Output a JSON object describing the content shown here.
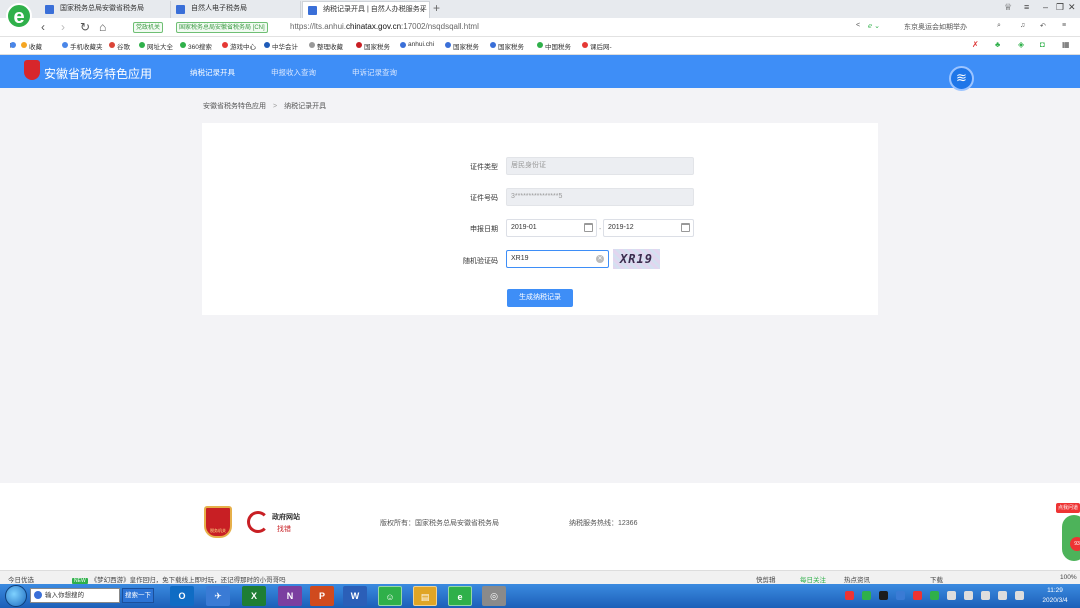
{
  "browser": {
    "logo_letter": "e",
    "tabs": [
      {
        "label": "国家税务总局安徽省税务局"
      },
      {
        "label": "自然人电子税务局"
      },
      {
        "label": "纳税记录开具 | 自然人办税服务平"
      }
    ],
    "tab_close": "×",
    "new_tab": "+",
    "addr": {
      "badge_gov": "党政机关",
      "badge_site": "国家税务总局安徽省税务局 [CN]",
      "url_prefix": "https://lts.anhui.",
      "url_domain": "chinatax.gov.cn",
      "url_suffix": ":17002/nsqdsqall.html",
      "news_hint": "东京奥运会如期举办"
    },
    "bookmarks": [
      {
        "label": "收藏",
        "color": "#f5a623"
      },
      {
        "label": "手机收藏夹",
        "color": "#4a86e8"
      },
      {
        "label": "谷歌",
        "color": "#db4437"
      },
      {
        "label": "网址大全",
        "color": "#2fb04a"
      },
      {
        "label": "360搜索",
        "color": "#2fb04a"
      },
      {
        "label": "游戏中心",
        "color": "#e53935"
      },
      {
        "label": "中华会计",
        "color": "#1e5bb8"
      },
      {
        "label": "整理收藏",
        "color": "#999999"
      },
      {
        "label": "国家税务",
        "color": "#c81f24"
      },
      {
        "label": "anhui.chi",
        "color": "#3a6fd8"
      },
      {
        "label": "国家税务",
        "color": "#3a6fd8"
      },
      {
        "label": "国家税务",
        "color": "#3a6fd8"
      },
      {
        "label": "中国税务",
        "color": "#2fb04a"
      },
      {
        "label": "课后网-",
        "color": "#e53935"
      }
    ]
  },
  "site": {
    "title": "安徽省税务特色应用",
    "nav": [
      {
        "label": "纳税记录开具"
      },
      {
        "label": "申报收入查询"
      },
      {
        "label": "申诉记录查询"
      }
    ],
    "breadcrumb": {
      "root": "安徽省税务特色应用",
      "sep": ">",
      "current": "纳税记录开具"
    }
  },
  "form": {
    "id_type_label": "证件类型",
    "id_type_value": "居民身份证",
    "id_number_label": "证件号码",
    "id_number_value": "3****************5",
    "date_label": "申报日期",
    "date_start": "2019-01",
    "date_sep": "-",
    "date_end": "2019-12",
    "captcha_label": "随机验证码",
    "captcha_input": "XR19",
    "captcha_image_text": "XR19",
    "submit_label": "生成纳税记录"
  },
  "footer": {
    "emblem_caption": "税务机关",
    "gov_site_title": "政府网站",
    "gov_site_sub": "找错",
    "copyright": "版权所有：国家税务总局安徽省税务局",
    "hotline": "纳税服务热线：12366",
    "float_tag": "点我问道",
    "float_num": "93"
  },
  "statusbar": {
    "left": "今日优选",
    "new_badge": "NEW",
    "news": "《梦幻西游》皇作回归，免下载线上即时玩，还记得那时的小哥哥吗",
    "items": [
      "快剪辑",
      "每日关注",
      "热点资讯",
      "下载"
    ],
    "zoom": "100%"
  },
  "taskbar": {
    "search_placeholder": "输入你想搜的",
    "search_button": "搜索一下",
    "apps": [
      {
        "label": "O",
        "color": "#0f6cc4"
      },
      {
        "label": "✈",
        "color": "#3a7bd5"
      },
      {
        "label": "X",
        "color": "#1e7e34"
      },
      {
        "label": "N",
        "color": "#7b3fa0"
      },
      {
        "label": "P",
        "color": "#d04a1e"
      },
      {
        "label": "W",
        "color": "#2b5fb8"
      },
      {
        "label": "☺",
        "color": "#2fb04a"
      },
      {
        "label": "▤",
        "color": "#e0a526"
      },
      {
        "label": "e",
        "color": "#2fb04a"
      },
      {
        "label": "◎",
        "color": "#8a8a8a"
      }
    ],
    "time": "11:29",
    "date": "2020/3/4"
  }
}
